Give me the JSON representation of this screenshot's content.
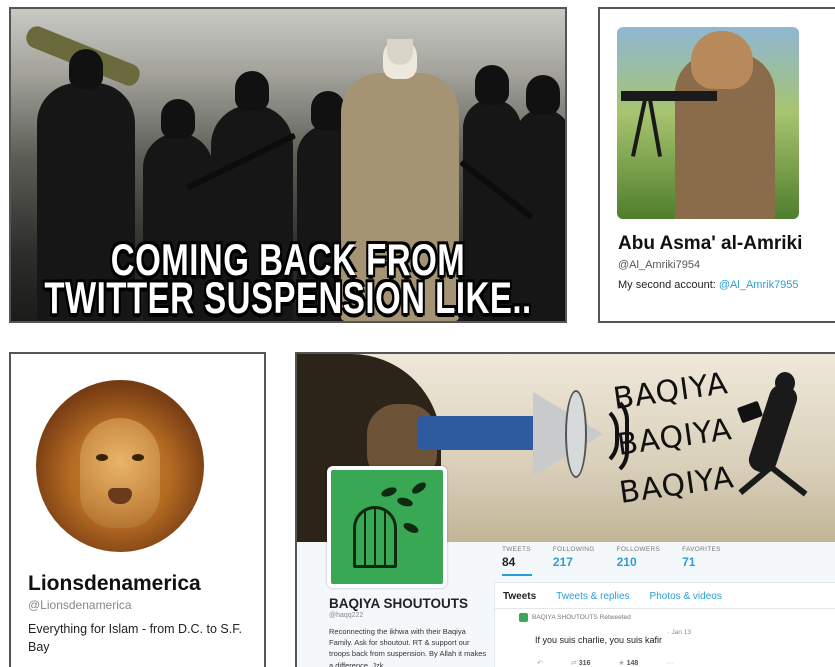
{
  "meme": {
    "caption_line1": "COMING BACK FROM",
    "caption_line2": "TWITTER SUSPENSION LIKE.."
  },
  "profile1": {
    "name": "Abu Asma' al-Amriki",
    "handle": "@Al_Amriki7954",
    "bio_prefix": "My second account: ",
    "bio_link": "@Al_Amrik7955"
  },
  "profile2": {
    "name": "Lionsdenamerica",
    "handle": "@Lionsdenamerica",
    "bio": "Everything for Islam - from D.C. to S.F. Bay"
  },
  "profile3": {
    "header_text": [
      "BAQIYA",
      "BAQIYA",
      "BAQIYA"
    ],
    "stats": [
      {
        "label": "TWEETS",
        "value": "84"
      },
      {
        "label": "FOLLOWING",
        "value": "217"
      },
      {
        "label": "FOLLOWERS",
        "value": "210"
      },
      {
        "label": "FAVORITES",
        "value": "71"
      }
    ],
    "name": "BAQIYA SHOUTOUTS",
    "handle": "@haqq222",
    "bio": "Reconnecting the ikhwa with their Baqiya Family. Ask for shoutout. RT & support our troops back from suspension. By Allah it makes a difference, Jzk",
    "tabs": [
      "Tweets",
      "Tweets & replies",
      "Photos & videos"
    ],
    "retweet_label": "BAQIYA SHOUTOUTS Retweeted",
    "tweet_date": "· Jan 13",
    "tweet_text": "If you suis charlie, you suis kafir",
    "retweets": "316",
    "favorites": "148",
    "more": "···"
  },
  "colors": {
    "link": "#2a9fd6",
    "avatar_green": "#38a854"
  }
}
